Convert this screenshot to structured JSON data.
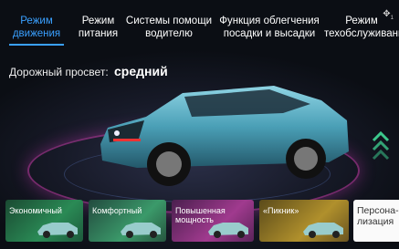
{
  "tabs": [
    {
      "line1": "Режим",
      "line2": "движения",
      "active": true
    },
    {
      "line1": "Режим",
      "line2": "питания",
      "active": false
    },
    {
      "line1": "Системы помощи",
      "line2": "водителю",
      "active": false
    },
    {
      "line1": "Функция облегчения",
      "line2": "посадки и высадки",
      "active": false
    },
    {
      "line1": "Режим",
      "line2": "техобслуживания",
      "active": false
    }
  ],
  "settings_icon": "gear-icon",
  "settings_badge": "1",
  "clearance": {
    "label": "Дорожный просвет:",
    "value": "средний"
  },
  "modes": [
    {
      "label": "Экономичный"
    },
    {
      "label": "Комфортный"
    },
    {
      "label_line1": "Повышенная",
      "label_line2": "мощность"
    },
    {
      "label": "«Пикник»"
    },
    {
      "label_line1": "Персона-",
      "label_line2": "лизация"
    }
  ],
  "colors": {
    "accent": "#3aa0ff",
    "car": "#5fb3c8",
    "ring": "#c83caa",
    "chevron": "#3cc88c"
  }
}
